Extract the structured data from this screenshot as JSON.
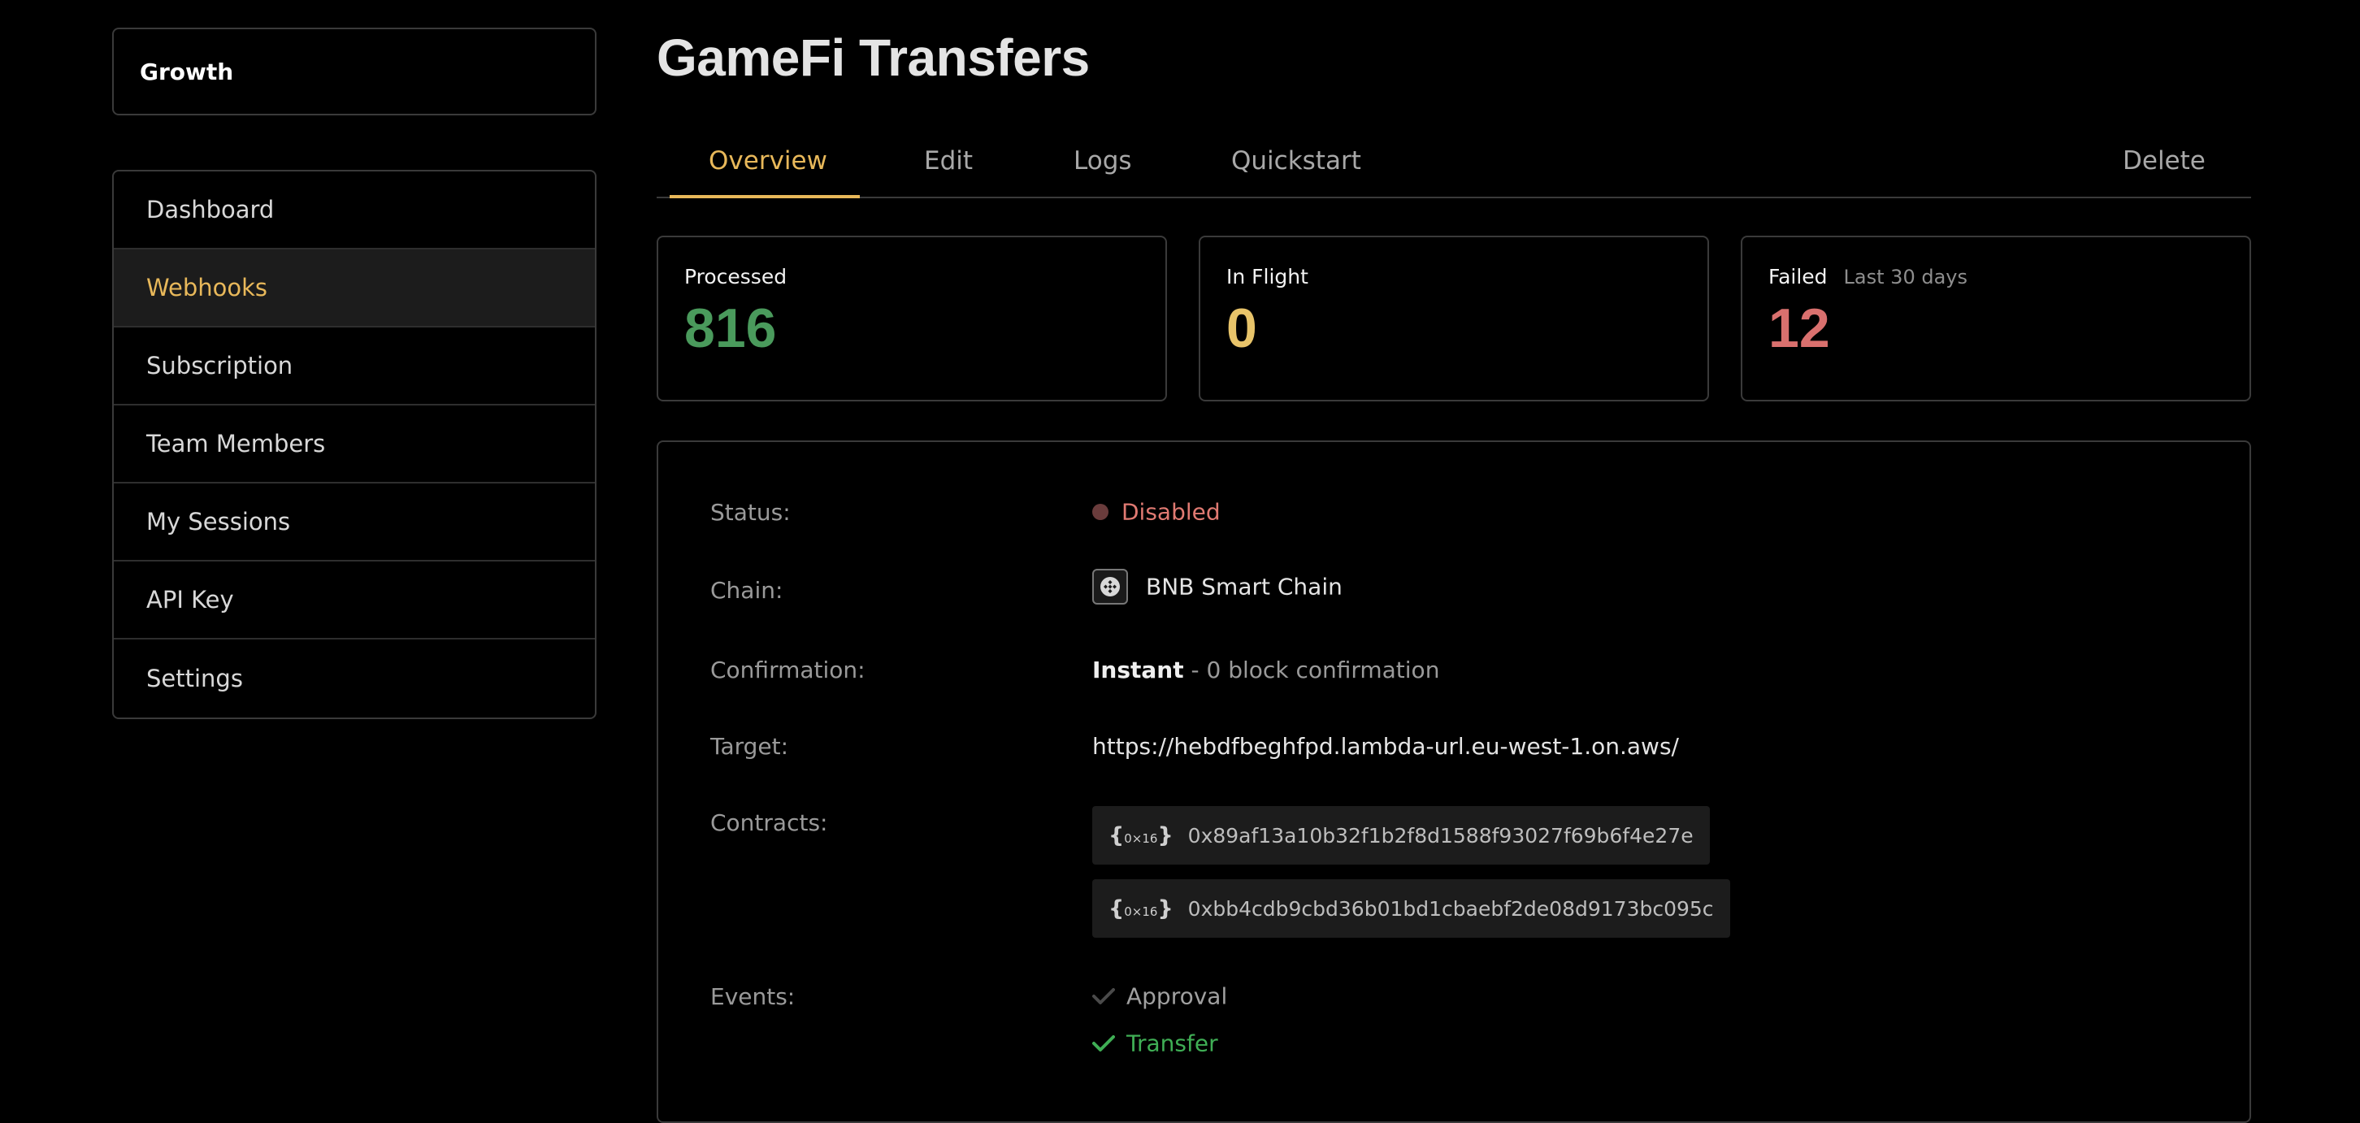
{
  "workspace": {
    "name": "Growth"
  },
  "sidebar": {
    "items": [
      {
        "label": "Dashboard"
      },
      {
        "label": "Webhooks"
      },
      {
        "label": "Subscription"
      },
      {
        "label": "Team Members"
      },
      {
        "label": "My Sessions"
      },
      {
        "label": "API Key"
      },
      {
        "label": "Settings"
      }
    ],
    "active": "Webhooks"
  },
  "page": {
    "title": "GameFi Transfers"
  },
  "tabs": {
    "overview": "Overview",
    "edit": "Edit",
    "logs": "Logs",
    "quickstart": "Quickstart",
    "delete": "Delete",
    "active": "Overview"
  },
  "stats": {
    "processed": {
      "label": "Processed",
      "value": "816"
    },
    "in_flight": {
      "label": "In Flight",
      "value": "0"
    },
    "failed": {
      "label": "Failed",
      "sublabel": "Last 30 days",
      "value": "12"
    }
  },
  "details": {
    "status": {
      "label": "Status:",
      "value": "Disabled"
    },
    "chain": {
      "label": "Chain:",
      "value": "BNB Smart Chain",
      "icon": "bnb-chain-icon"
    },
    "confirmation": {
      "label": "Confirmation:",
      "mode": "Instant",
      "detail": " - 0 block confirmation"
    },
    "target": {
      "label": "Target:",
      "value": "https://hebdfbeghfpd.lambda-url.eu-west-1.on.aws/"
    },
    "contracts": {
      "label": "Contracts:",
      "badge_open": "{",
      "badge_text": "0×16",
      "badge_close": "}",
      "items": [
        "0x89af13a10b32f1b2f8d1588f93027f69b6f4e27e",
        "0xbb4cdb9cbd36b01bd1cbaebf2de08d9173bc095c"
      ]
    },
    "events": {
      "label": "Events:",
      "items": [
        {
          "name": "Approval",
          "enabled": false
        },
        {
          "name": "Transfer",
          "enabled": true
        }
      ]
    }
  },
  "colors": {
    "accent": "#e8b85a",
    "processed": "#4a9a5c",
    "in_flight": "#e8c46a",
    "failed": "#d9706e",
    "status_disabled": "#e07a72",
    "event_enabled": "#3fae55",
    "event_disabled": "#4a4a4a"
  }
}
